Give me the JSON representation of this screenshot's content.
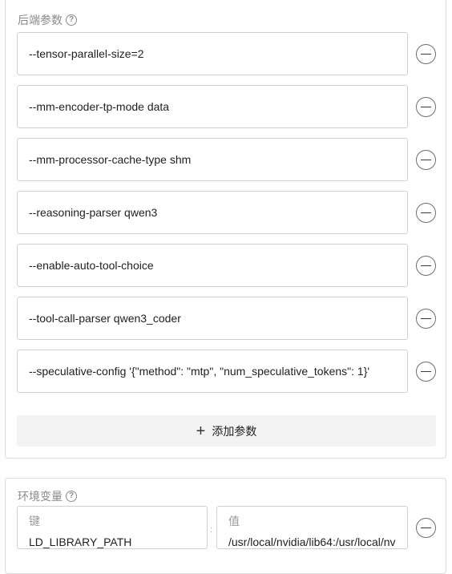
{
  "backend_args": {
    "title": "后端参数",
    "help": "?",
    "items": [
      "--tensor-parallel-size=2",
      "--mm-encoder-tp-mode data",
      "--mm-processor-cache-type shm",
      "--reasoning-parser qwen3",
      "--enable-auto-tool-choice",
      "--tool-call-parser qwen3_coder",
      "--speculative-config '{\"method\": \"mtp\", \"num_speculative_tokens\": 1}'"
    ],
    "add_label": "添加参数"
  },
  "env_vars": {
    "title": "环境变量",
    "help": "?",
    "key_label": "键",
    "value_label": "值",
    "separator": ":",
    "rows": [
      {
        "key": "LD_LIBRARY_PATH",
        "value": "/usr/local/nvidia/lib64:/usr/local/nv"
      }
    ]
  }
}
